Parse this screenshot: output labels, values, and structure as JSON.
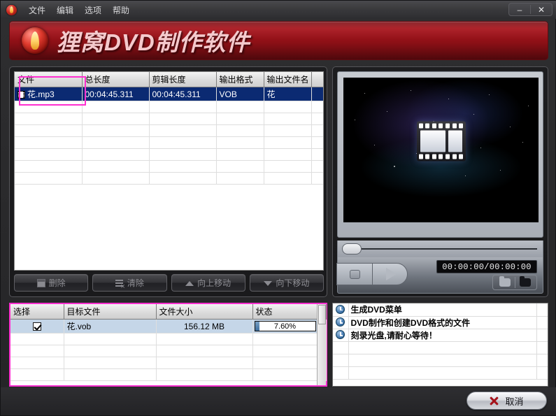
{
  "window": {
    "menu": [
      "文件",
      "编辑",
      "选项",
      "帮助"
    ],
    "minimize_label": "–",
    "close_label": "✕"
  },
  "banner": {
    "title": "狸窝DVD制作软件"
  },
  "file_list": {
    "columns": [
      "文件",
      "总长度",
      "剪辑长度",
      "输出格式",
      "输出文件名",
      ""
    ],
    "rows": [
      {
        "file": "花.mp3",
        "total_length": "00:04:45.311",
        "clip_length": "00:04:45.311",
        "output_format": "VOB",
        "output_name": "花",
        "extra": "",
        "selected": true
      }
    ],
    "buttons": [
      {
        "label": "删除",
        "icon": "delete-icon"
      },
      {
        "label": "清除",
        "icon": "clear-icon"
      },
      {
        "label": "向上移动",
        "icon": "move-up-icon"
      },
      {
        "label": "向下移动",
        "icon": "move-down-icon"
      }
    ]
  },
  "preview": {
    "timecode": "00:00:00/00:00:00",
    "stop_icon": "stop-icon",
    "play_icon": "play-icon",
    "folder_open_icon": "folder-open-icon",
    "folder_closed_icon": "folder-closed-icon",
    "seek_position_percent": 0
  },
  "target_list": {
    "columns": [
      "选择",
      "目标文件",
      "文件大小",
      "状态"
    ],
    "rows": [
      {
        "checked": true,
        "target_file": "花.vob",
        "file_size": "156.12 MB",
        "status_percent": 7.6,
        "status_label": "7.60%"
      }
    ]
  },
  "log": {
    "entries": [
      {
        "icon": "clock-icon",
        "text": "生成DVD菜单"
      },
      {
        "icon": "clock-icon",
        "text": "DVD制作和创建DVD格式的文件"
      },
      {
        "icon": "clock-icon",
        "text": "刻录光盘,请耐心等待！"
      }
    ]
  },
  "actions": {
    "cancel_label": "取消"
  },
  "colors": {
    "brand_red": "#a8141c",
    "focus_magenta": "#ff2fd0",
    "selection_blue": "#0b2a72",
    "row_highlight": "#c5d6e8",
    "progress_blue": "#3f6f9e"
  }
}
